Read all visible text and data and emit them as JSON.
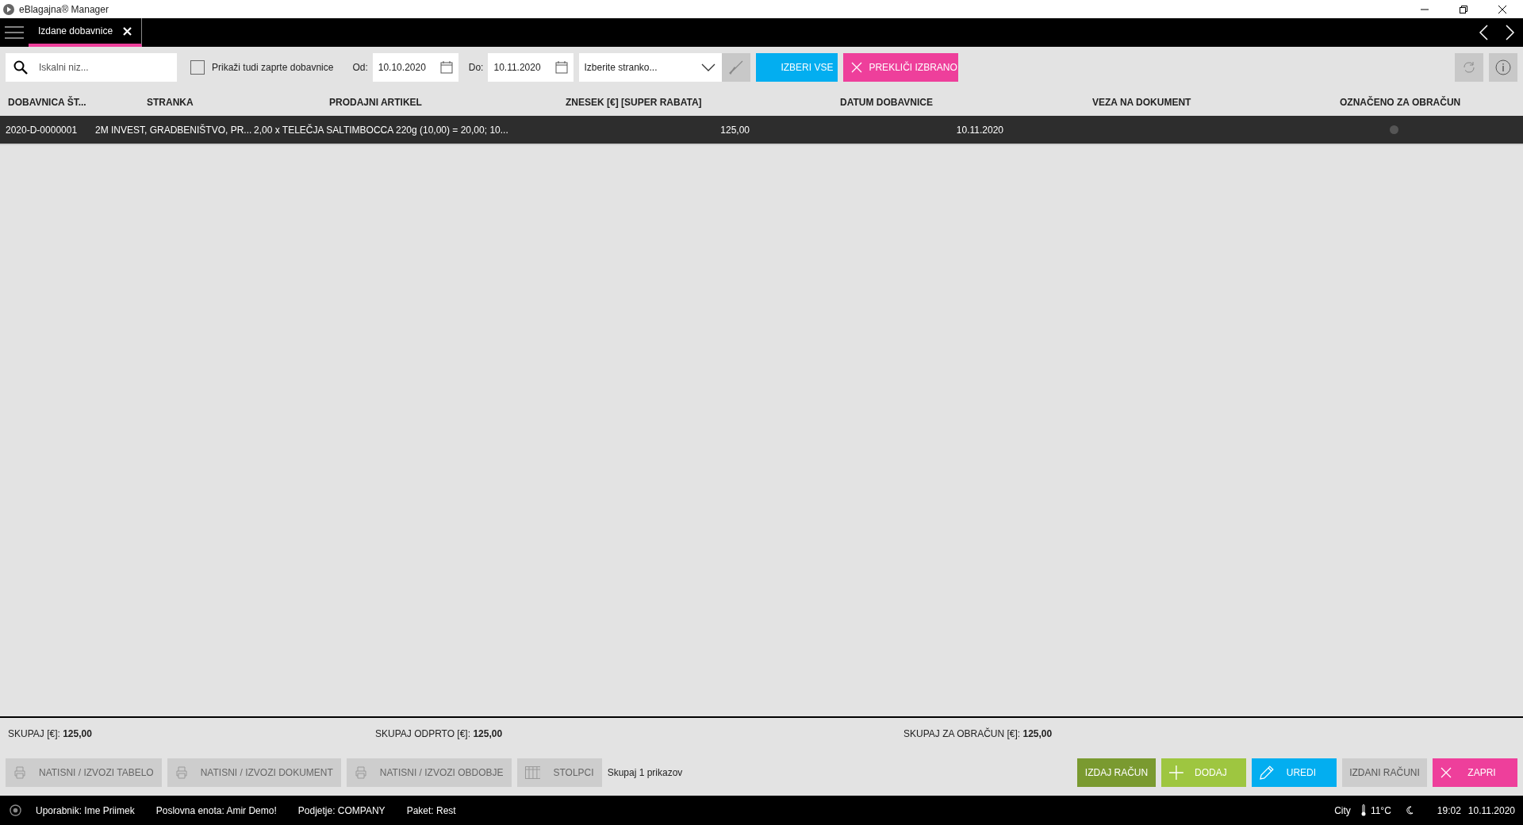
{
  "window": {
    "title": "eBlagajna® Manager"
  },
  "tabs": [
    {
      "label": "Izdane dobavnice",
      "selected": true
    }
  ],
  "toolbar": {
    "search": {
      "placeholder": "Iskalni niz..."
    },
    "show_closed": {
      "label": "Prikaži tudi zaprte dobavnice",
      "checked": false
    },
    "from": {
      "label": "Od:",
      "value": "10.10.2020"
    },
    "to": {
      "label": "Do:",
      "value": "10.11.2020"
    },
    "customer": {
      "placeholder": "Izberite stranko..."
    },
    "buttons": [
      {
        "label": "IZBERI VSE",
        "kind": "select"
      },
      {
        "label": "PREKLIČI IZBRANO",
        "kind": "cancel"
      }
    ]
  },
  "table": {
    "columns": [
      "DOBAVNICA ŠT...",
      "STRANKA",
      "PRODAJNI ARTIKEL",
      "ZNESEK [€] [SUPER RABATA]",
      "DATUM DOBAVNICE",
      "VEZA NA DOKUMENT",
      "OZNAČENO ZA OBRAČUN"
    ],
    "rows": [
      {
        "selected": true,
        "number": "2020-D-0000001",
        "customer": "2M INVEST, GRADBENIŠTVO, PR...",
        "article": "2,00 x TELEČJA SALTIMBOCCA 220g (10,00) = 20,00; 10...",
        "amount": "125,00",
        "date": "10.11.2020",
        "marked": false
      }
    ]
  },
  "totals": [
    {
      "label": "SKUPAJ [€]:",
      "value": "125,00"
    },
    {
      "label": "SKUPAJ ODPRTO [€]:",
      "value": "125,00"
    },
    {
      "label": "SKUPAJ ZA OBRAČUN [€]:",
      "value": "125,00"
    }
  ],
  "left_buttons": [
    {
      "label": "NATISNI / IZVOZI TABELO",
      "kind": "print"
    },
    {
      "label": "NATISNI / IZVOZI DOKUMENT",
      "kind": "print"
    },
    {
      "label": "NATISNI / IZVOZI OBDOBJE",
      "kind": "print"
    },
    {
      "label": "STOLPCI",
      "kind": "columns"
    }
  ],
  "count": "Skupaj 1 prikazov",
  "right_buttons": [
    {
      "label": "IZDAJ RAČUN",
      "kind": "invoice"
    },
    {
      "label": "DODAJ",
      "kind": "add"
    },
    {
      "label": "UREDI",
      "kind": "edit"
    },
    {
      "label": "IZDANI RAČUNI",
      "kind": "list"
    },
    {
      "label": "ZAPRI",
      "kind": "close"
    }
  ],
  "status_bar": {
    "items": [
      "Uporabnik: Ime Priimek",
      "Poslovna enota: Amir Demo!",
      "Podjetje: COMPANY",
      "Paket: Rest"
    ],
    "city": "City",
    "temperature": "11°C",
    "time": "19:02",
    "date": "10.11.2020"
  }
}
